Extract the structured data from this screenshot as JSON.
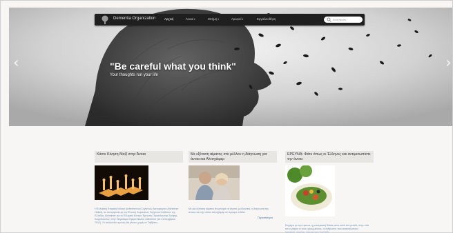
{
  "nav": {
    "brand": "Dementia Organization",
    "items": [
      {
        "label": "Αρχική",
        "caret": ""
      },
      {
        "label": "Άνοια",
        "caret": "▾"
      },
      {
        "label": "Μνήμη",
        "caret": "▾"
      },
      {
        "label": "Αρωγοί",
        "caret": "▾"
      },
      {
        "label": "Εργαλειοθήκη",
        "caret": ""
      }
    ],
    "search_placeholder": "Αναζήτηση"
  },
  "slider": {
    "quote": "\"Be careful what you think\"",
    "subtitle": "Your thoughts run your life",
    "prev_icon": "chevron-left-icon",
    "next_icon": "chevron-right-icon"
  },
  "columns": [
    {
      "heading": "Κάντε Κίνηση Μαζί στην Άνοια",
      "text": "Η Ελληνική Εταιρεία Νόσου Alzheimer και Συγγενών Διαταραχών (Alzheimer Hellas), σε συνεργασία με την Ένωση Σωματείων Συγγενών Ασθενών της Ελλάδος Alzheimer και το Ελληνικό Κέντρο Έρευνας Προσέλκυσης Σκέψης, διοργάνωσαν, στην Παγκόσμια Ημέρα Νόσου Alzheimer (21 Σεπτεμβρίου 2012). Οι ακόλουθοι αγώνες θα γίνουν χωρίς το Σάββατο..."
    },
    {
      "heading": "Με εξέταση αίματος στο μέλλον η διάγνωση για άνοια και Αλτσχάιμερ",
      "text": "Με μία εξέταση αίματος θα μπορεί να γίνεται, μελλοντικά, η διάγνωση της άνοιας και της νόσου Αλτσχάιμερ σε πρώιμο στάδιο.",
      "more": "Περισσότερα"
    },
    {
      "heading": "ΕΡΕΥΝΑ: Φάτε όπως οι Έλληνες και αντιμετωπίστε την άνοια",
      "text": "Στηρίχτε με την έρευνα, η μεσογειακή δίαιτα κάνει καλό στο μυαλό, στην ελιά και ο μακρο οι τους ηλικιωμένους, οι άνθρωποι που καταναλώνουν λαχανικά, φρούτα, όσπρια και ελαιόλαδο..."
    }
  ]
}
